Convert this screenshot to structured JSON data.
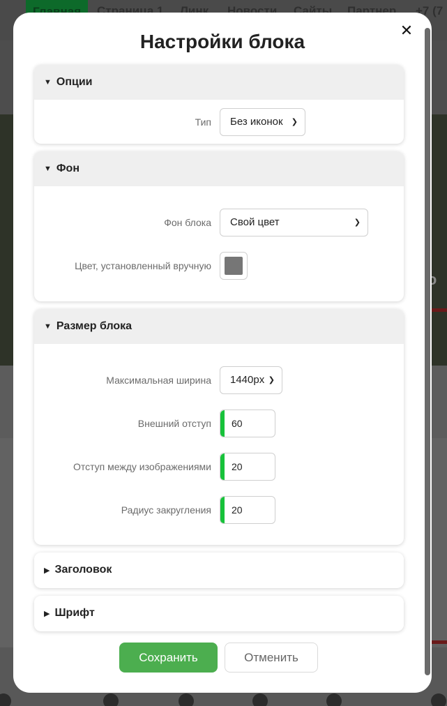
{
  "background_page": {
    "nav": [
      "Главная",
      "Страница 1",
      "Линк",
      "Новости",
      "Сайты",
      "Партнер",
      "+7 (7"
    ],
    "edge_text": "го"
  },
  "modal": {
    "title": "Настройки блока",
    "close_icon": "close-icon"
  },
  "sections": {
    "options": {
      "title": "Опции",
      "expanded": true,
      "type_label": "Тип",
      "type_value": "Без иконок"
    },
    "background": {
      "title": "Фон",
      "expanded": true,
      "bg_label": "Фон блока",
      "bg_value": "Свой цвет",
      "color_label": "Цвет, установленный вручную",
      "color_value": "#767676"
    },
    "size": {
      "title": "Размер блока",
      "expanded": true,
      "max_width_label": "Максимальная ширина",
      "max_width_value": "1440px",
      "outer_margin_label": "Внешний отступ",
      "outer_margin_value": "60",
      "gap_label": "Отступ между изображениями",
      "gap_value": "20",
      "radius_label": "Радиус закругления",
      "radius_value": "20"
    },
    "heading": {
      "title": "Заголовок",
      "expanded": false
    },
    "font": {
      "title": "Шрифт",
      "expanded": false
    }
  },
  "buttons": {
    "save": "Сохранить",
    "cancel": "Отменить"
  },
  "colors": {
    "save_bg": "#4cae4f",
    "input_accent": "#17c23a"
  }
}
